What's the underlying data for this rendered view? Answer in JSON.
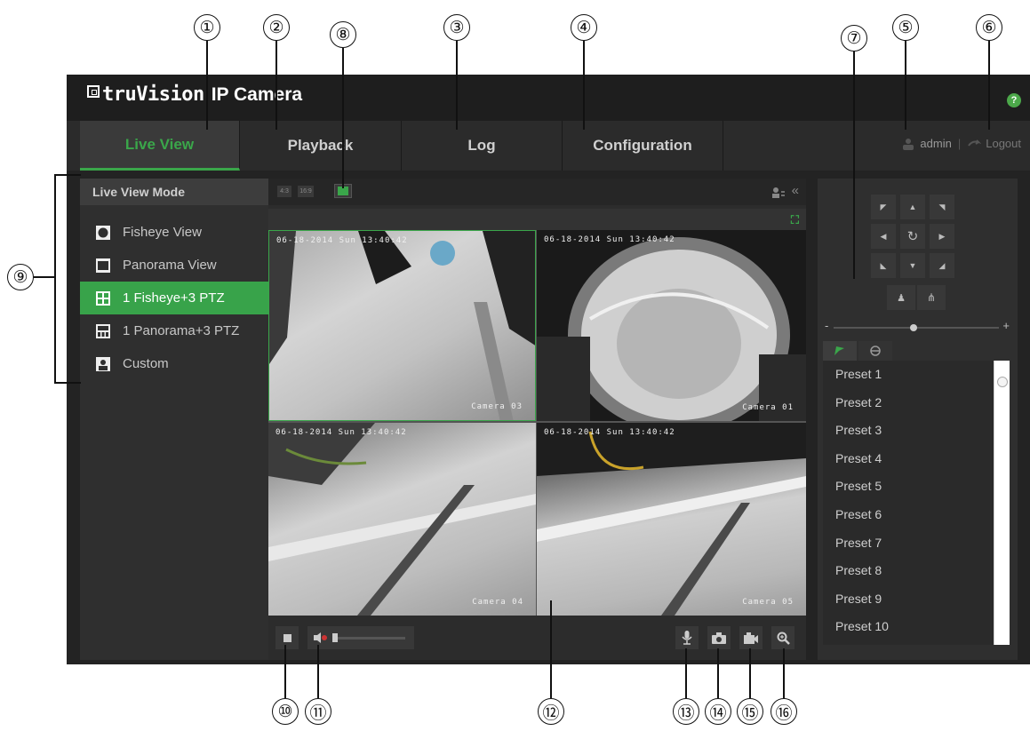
{
  "app": {
    "brand": "truVision",
    "product": "IP Camera",
    "help_label": "?"
  },
  "nav": {
    "tabs": [
      {
        "label": "Live View",
        "active": true
      },
      {
        "label": "Playback",
        "active": false
      },
      {
        "label": "Log",
        "active": false
      },
      {
        "label": "Configuration",
        "active": false
      }
    ],
    "user": "admin",
    "logout": "Logout"
  },
  "left_panel": {
    "header": "Live View Mode",
    "modes": [
      {
        "label": "Fisheye View",
        "icon": "fisheye-icon",
        "active": false
      },
      {
        "label": "Panorama View",
        "icon": "panorama-icon",
        "active": false
      },
      {
        "label": "1 Fisheye+3 PTZ",
        "icon": "quad-grid-icon",
        "active": true
      },
      {
        "label": "1 Panorama+3 PTZ",
        "icon": "panorama-grid-icon",
        "active": false
      },
      {
        "label": "Custom",
        "icon": "user-icon",
        "active": false
      }
    ]
  },
  "center": {
    "ratio_buttons": [
      "4:3",
      "16:9"
    ],
    "tiles": [
      {
        "date": "06-18-2014 Sun 13:40:42",
        "camera": "Camera 03"
      },
      {
        "date": "06-18-2014 Sun 13:40:42",
        "camera": "Camera 01"
      },
      {
        "date": "06-18-2014 Sun 13:40:42",
        "camera": "Camera 04"
      },
      {
        "date": "06-18-2014 Sun 13:40:42",
        "camera": "Camera 05"
      }
    ]
  },
  "presets": {
    "items": [
      "Preset 1",
      "Preset 2",
      "Preset 3",
      "Preset 4",
      "Preset 5",
      "Preset 6",
      "Preset 7",
      "Preset 8",
      "Preset 9",
      "Preset 10"
    ]
  },
  "zoom": {
    "minus": "-",
    "plus": "+"
  },
  "colors": {
    "accent": "#38a34a",
    "background": "#232323",
    "panel": "#2f2f2f"
  },
  "callouts": [
    "①",
    "②",
    "③",
    "④",
    "⑤",
    "⑥",
    "⑦",
    "⑧",
    "⑨",
    "⑩",
    "⑪",
    "⑫",
    "⑬",
    "⑭",
    "⑮",
    "⑯"
  ]
}
